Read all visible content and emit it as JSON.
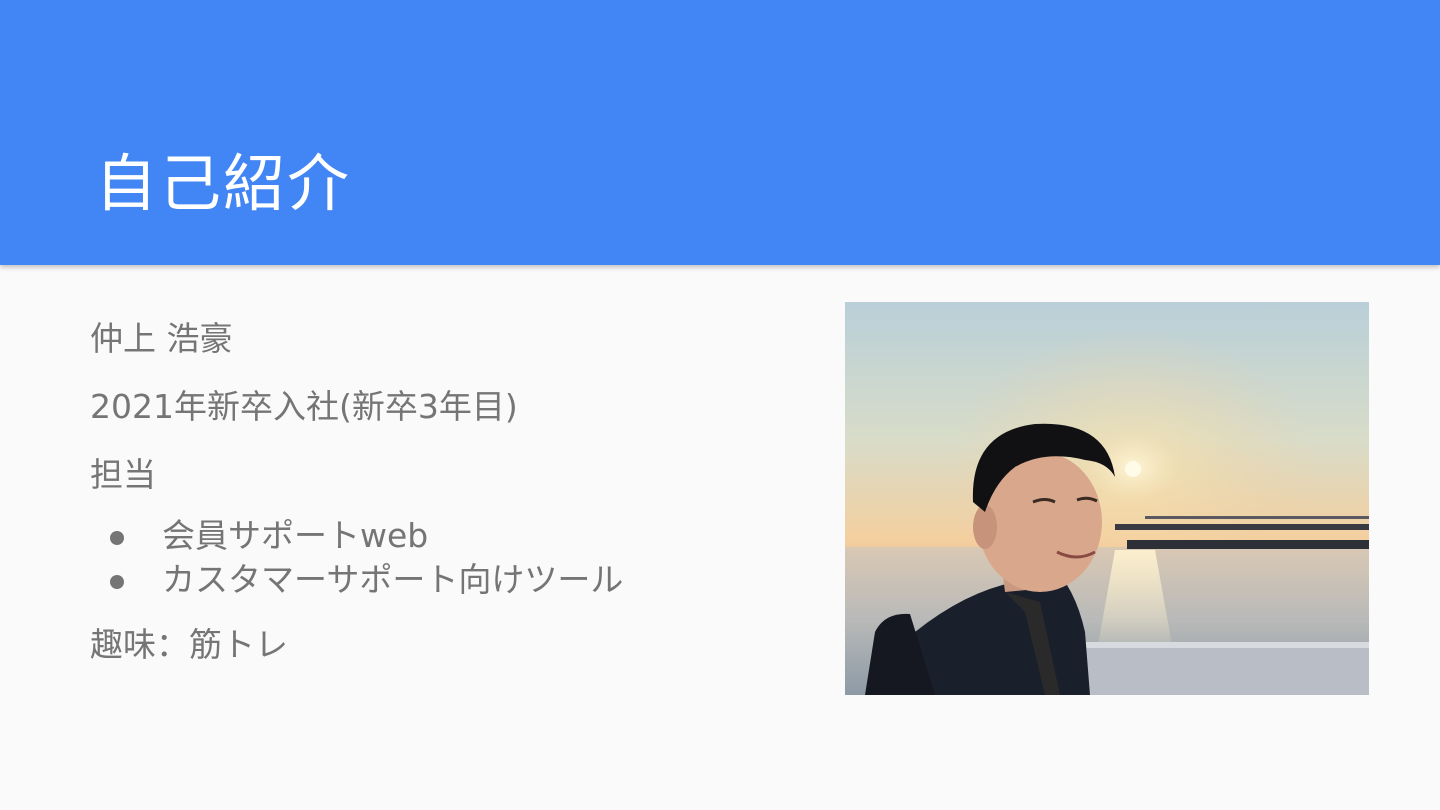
{
  "slide": {
    "title": "自己紹介",
    "name": "仲上 浩豪",
    "joined": "2021年新卒入社(新卒3年目)",
    "responsibility_label": "担当",
    "responsibilities": [
      "会員サポートweb",
      "カスタマーサポート向けツール"
    ],
    "hobby": "趣味：筋トレ"
  },
  "colors": {
    "header": "#4285f4",
    "text": "#757575",
    "background": "#fafafa"
  },
  "photo": {
    "subject": "portrait-photo-sunset-waterfront"
  }
}
